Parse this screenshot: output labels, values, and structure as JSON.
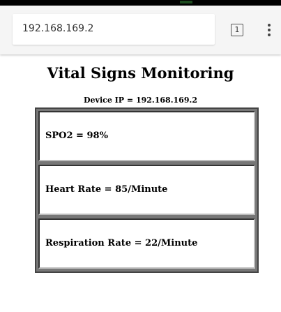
{
  "browser": {
    "url": "192.168.169.2",
    "tab_count": "1",
    "menu_icon": "more-vertical-icon",
    "tab_icon": "tab-switcher-icon"
  },
  "page": {
    "title": "Vital Signs Monitoring",
    "device_ip": "Device IP = 192.168.169.2"
  },
  "vitals": [
    {
      "text": "SPO2 = 98%"
    },
    {
      "text": "Heart Rate = 85/Minute"
    },
    {
      "text": "Respiration Rate = 22/Minute"
    }
  ]
}
